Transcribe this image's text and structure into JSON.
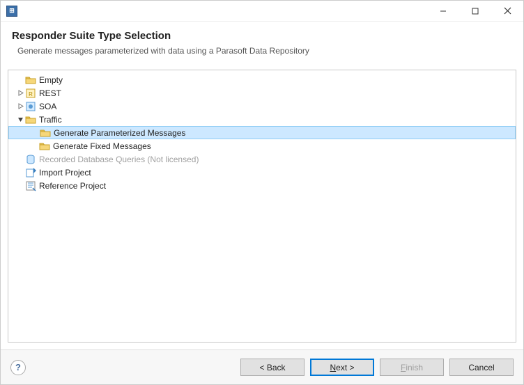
{
  "window": {
    "minimize_tooltip": "Minimize",
    "maximize_tooltip": "Maximize",
    "close_tooltip": "Close"
  },
  "header": {
    "title": "Responder Suite Type Selection",
    "subtitle": "Generate messages parameterized with data using a Parasoft Data Repository"
  },
  "tree": {
    "items": [
      {
        "label": "Empty",
        "indent": 0,
        "expander": "none",
        "icon": "folder",
        "selected": false,
        "disabled": false
      },
      {
        "label": "REST",
        "indent": 0,
        "expander": "closed",
        "icon": "rest",
        "selected": false,
        "disabled": false
      },
      {
        "label": "SOA",
        "indent": 0,
        "expander": "closed",
        "icon": "soa",
        "selected": false,
        "disabled": false
      },
      {
        "label": "Traffic",
        "indent": 0,
        "expander": "open",
        "icon": "folder",
        "selected": false,
        "disabled": false
      },
      {
        "label": "Generate Parameterized Messages",
        "indent": 1,
        "expander": "none",
        "icon": "folder",
        "selected": true,
        "disabled": false
      },
      {
        "label": "Generate Fixed Messages",
        "indent": 1,
        "expander": "none",
        "icon": "folder",
        "selected": false,
        "disabled": false
      },
      {
        "label": "Recorded Database Queries (Not licensed)",
        "indent": 0,
        "expander": "none",
        "icon": "db",
        "selected": false,
        "disabled": true
      },
      {
        "label": "Import Project",
        "indent": 0,
        "expander": "none",
        "icon": "import",
        "selected": false,
        "disabled": false
      },
      {
        "label": "Reference Project",
        "indent": 0,
        "expander": "none",
        "icon": "ref",
        "selected": false,
        "disabled": false
      }
    ]
  },
  "footer": {
    "help_tooltip": "Help",
    "back": "< Back",
    "next": "Next >",
    "finish": "Finish",
    "cancel": "Cancel"
  }
}
